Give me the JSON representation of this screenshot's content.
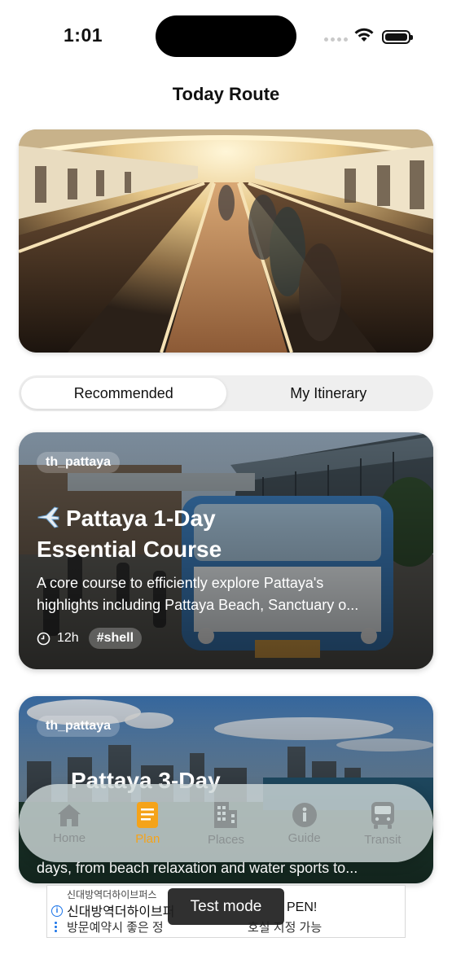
{
  "status_bar": {
    "time": "1:01"
  },
  "header": {
    "title": "Today Route"
  },
  "segments": {
    "recommended": "Recommended",
    "my_itinerary": "My Itinerary"
  },
  "cards": [
    {
      "tag": "th_pattaya",
      "title_line1": "Pattaya 1-Day",
      "title_line2": "Essential Course",
      "desc_line1": "A core course to efficiently explore Pattaya's",
      "desc_line2": "highlights including Pattaya Beach, Sanctuary o...",
      "duration": "12h",
      "hashtag": "#shell"
    },
    {
      "tag": "th_pattaya",
      "title_line1": "Pattaya 3-Day",
      "desc_line": "days, from beach relaxation and water sports to..."
    }
  ],
  "tabbar": {
    "home": "Home",
    "plan": "Plan",
    "places": "Places",
    "guide": "Guide",
    "transit": "Transit"
  },
  "ad": {
    "small": "신대방역더하이브퍼스",
    "line1": "신대방역더하이브퍼",
    "line1_end": "PEN!",
    "line2": "방문예약시 좋은 정",
    "line2_end": "호실 지정 가능"
  },
  "toast": {
    "text": "Test mode"
  },
  "colors": {
    "accent": "#f5a31a",
    "tab_inactive": "#8b9192"
  }
}
